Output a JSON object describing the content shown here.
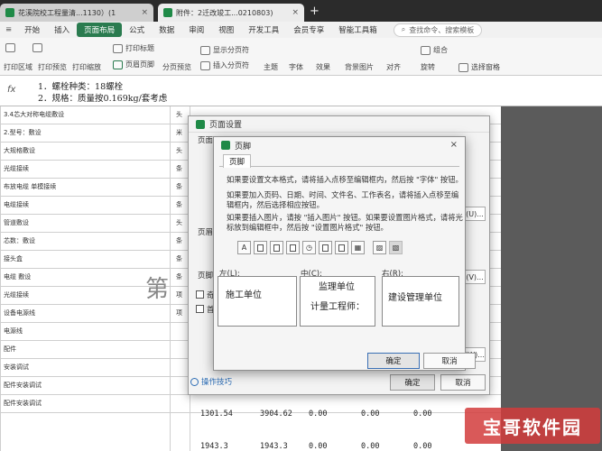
{
  "tabs": [
    {
      "label": "花溪院校工程量清...1130）(1",
      "close": "×"
    },
    {
      "label": "附件：2迁改竣工...0210803)",
      "close": "×"
    }
  ],
  "tab_plus": "+",
  "menu": {
    "items": [
      "开始",
      "插入",
      "页面布局",
      "公式",
      "数据",
      "审阅",
      "视图",
      "开发工具",
      "会员专享",
      "智能工具箱"
    ],
    "active_index": 2,
    "search_placeholder": "查找命令、搜索模板"
  },
  "ribbon": {
    "print_area": "打印区域",
    "print_preview": "打印预览",
    "print_scale": "打印缩放",
    "print_titles": "打印标题",
    "page_header": "页眉页脚",
    "page_break_preview": "分页预览",
    "show_page_break": "显示分页符",
    "insert_page_break": "插入分页符",
    "theme": "主题",
    "font": "字体",
    "effect": "效果",
    "background": "背景图片",
    "align": "对齐",
    "rotate": "旋转",
    "group": "组合",
    "select_pane": "选择窗格"
  },
  "formula": {
    "fx": "fx",
    "line1": "1．螺栓种类：18螺栓",
    "line2": "2．规格：质量按0.169kg/套考虑"
  },
  "sheet": {
    "rows": [
      "3.4芯大对称电缆敷设",
      "2.型号：敷设",
      "大规格敷设",
      "光缆接续",
      "布放电缆 单模接续",
      "电缆接续",
      "管道敷设",
      "芯数：敷设",
      "接头盒",
      "电缆 敷设",
      "光缆接续",
      "设备电源线",
      "电源线",
      "配件",
      "安装调试",
      "配件安装调试",
      "配件安装调试"
    ],
    "units": [
      "头",
      "米",
      "头",
      "条",
      "条",
      "条",
      "头",
      "条",
      "条",
      "条",
      "项",
      "项"
    ],
    "bottom_row_1": [
      "1301.54",
      "3904.62",
      "0.00",
      "0.00",
      "0.00"
    ],
    "bottom_row_2": [
      "1943.3",
      "1943.3",
      "0.00",
      "0.00",
      "0.00"
    ],
    "big_char": "第"
  },
  "outer_dialog": {
    "title": "页面设置",
    "tab": "页面",
    "header_label": "页眉(",
    "footer_label": "页脚(",
    "side1": "(U)...",
    "side2": "(V)...",
    "side3": "(W)...",
    "cb1": "奇",
    "cb2": "首",
    "ok": "确定",
    "cancel": "取消",
    "tips": "操作技巧"
  },
  "dialog": {
    "title": "页脚",
    "tab": "页脚",
    "close": "×",
    "instr1": "如果要设置文本格式，请将插入点移至编辑框内，然后按 \"字体\" 按钮。",
    "instr2": "如果要加入页码、日期、时间、文件名、工作表名，请将插入点移至编辑框内，然后选择相应按钮。",
    "instr3": "如果要插入图片，请按 \"插入图片\" 按钮。如果要设置图片格式，请将光标放到编辑框中，然后按 \"设置图片格式\" 按钮。",
    "toolbar_font": "A",
    "left_label": "左(L):",
    "center_label": "中(C):",
    "right_label": "右(R):",
    "left_text": "施工单位",
    "center_text1": "监理单位",
    "center_text2": "计量工程师：",
    "right_text": "建设管理单位",
    "ok": "确定",
    "cancel": "取消"
  },
  "watermark": "宝哥软件园",
  "colors": {
    "accent": "#2a7b4f",
    "link": "#2d6db5"
  }
}
